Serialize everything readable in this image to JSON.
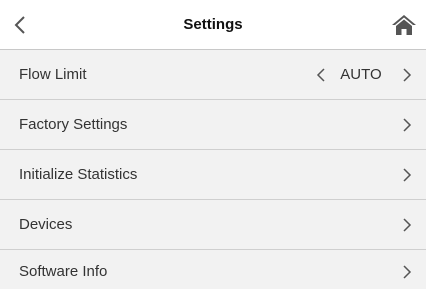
{
  "header": {
    "title": "Settings",
    "back_icon": "chevron-left-icon",
    "home_icon": "home-icon"
  },
  "colors": {
    "background": "#f2f2f2",
    "header_background": "#ffffff",
    "divider": "#cfcfcf",
    "text": "#333333",
    "icon": "#555555"
  },
  "settings": {
    "items": [
      {
        "label": "Flow Limit",
        "value": "AUTO",
        "has_value_picker": true
      },
      {
        "label": "Factory Settings"
      },
      {
        "label": "Initialize Statistics"
      },
      {
        "label": "Devices"
      },
      {
        "label": "Software Info"
      }
    ]
  }
}
